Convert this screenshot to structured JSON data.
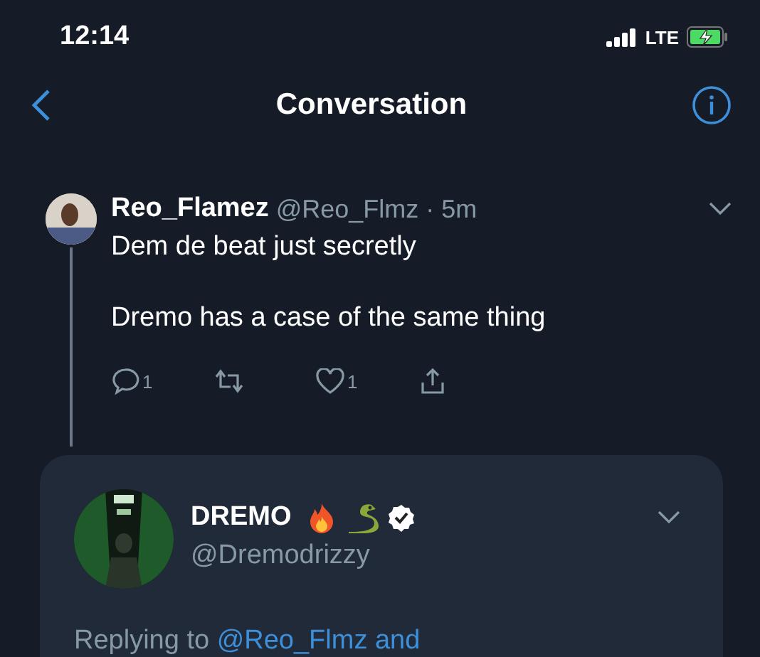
{
  "status_bar": {
    "time": "12:14",
    "network": "LTE"
  },
  "header": {
    "title": "Conversation"
  },
  "reply": {
    "name": "Reo_Flamez",
    "handle": "@Reo_Flmz",
    "time": "· 5m",
    "paragraphs": [
      "Dem de beat just secretly",
      "Dremo has a case of the same thing"
    ],
    "actions": [
      {
        "kind": "reply",
        "count": "1"
      },
      {
        "kind": "retweet"
      },
      {
        "kind": "like",
        "count": "1"
      },
      {
        "kind": "share"
      }
    ]
  },
  "main_tweet": {
    "name": "DREMO",
    "verified": true,
    "handle": "@Dremodrizzy",
    "replying_prefix": "Replying to",
    "replying_link": "@Reo_Flmz and"
  }
}
